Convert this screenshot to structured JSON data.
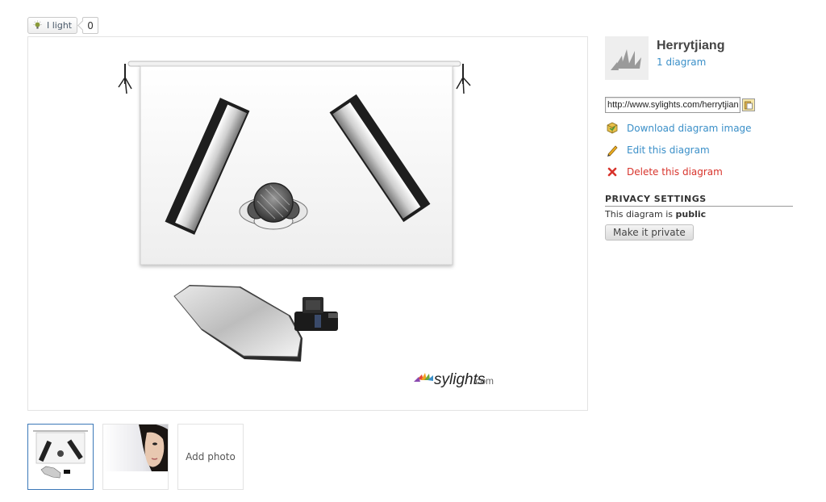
{
  "light": {
    "button_label": "I light",
    "count": "0",
    "icon": "lightbulb-icon"
  },
  "diagram": {
    "watermark_brand": "sylights",
    "watermark_suffix": ".com"
  },
  "thumbnails": {
    "add_photo_label": "Add photo"
  },
  "user": {
    "name": "Herrytjiang",
    "diagram_count": "1 diagram"
  },
  "share": {
    "url_value": "http://www.sylights.com/herrytjiang"
  },
  "actions": {
    "download": "Download diagram image",
    "edit": "Edit this diagram",
    "delete": "Delete this diagram"
  },
  "privacy": {
    "title": "PRIVACY SETTINGS",
    "text_prefix": "This diagram is ",
    "status": "public",
    "button": "Make it private"
  },
  "colors": {
    "link": "#3a8fc8",
    "danger": "#d8342c",
    "active_border": "#3b78b8"
  }
}
